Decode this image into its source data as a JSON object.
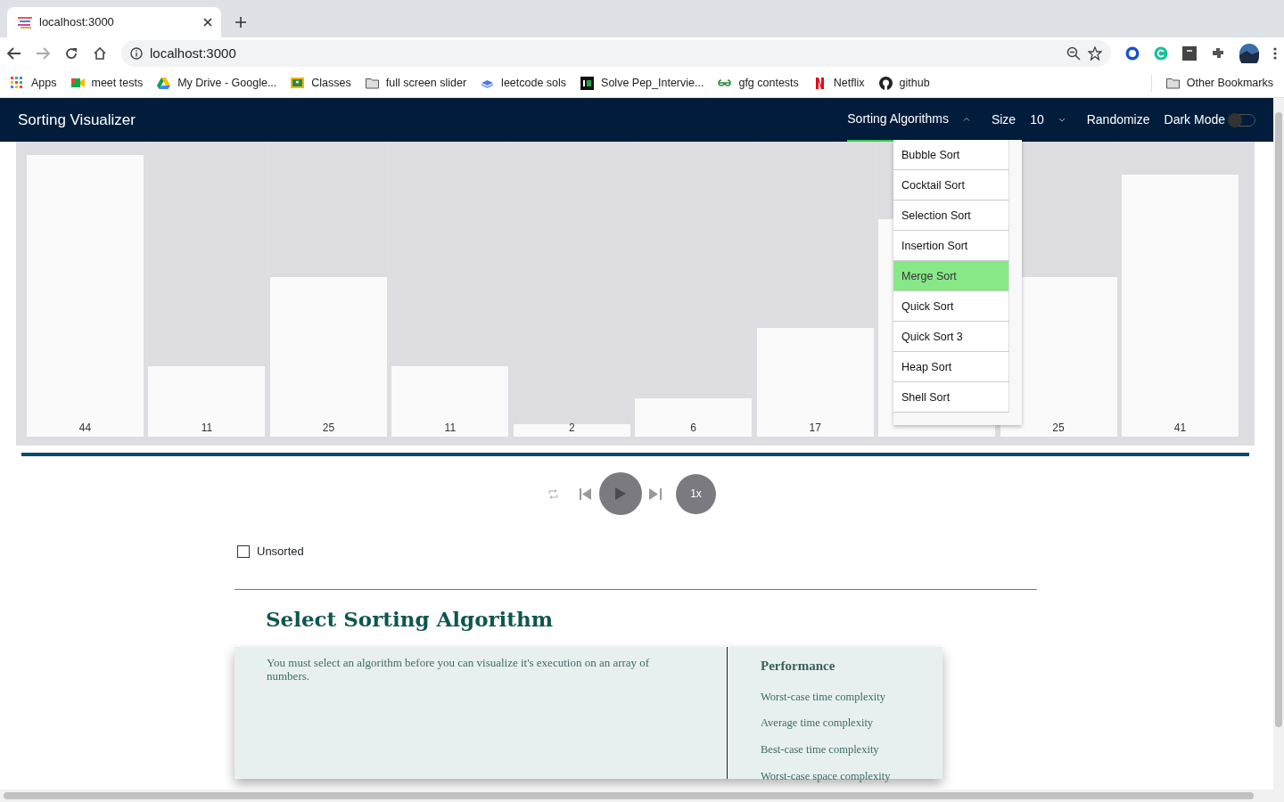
{
  "browser": {
    "tab": {
      "title": "localhost:3000"
    },
    "address": "localhost:3000",
    "bookmarks": [
      {
        "label": "Apps",
        "kind": "apps"
      },
      {
        "label": "meet tests",
        "kind": "meet"
      },
      {
        "label": "My Drive - Google...",
        "kind": "drive"
      },
      {
        "label": "Classes",
        "kind": "classroom"
      },
      {
        "label": "full screen slider",
        "kind": "folder"
      },
      {
        "label": "leetcode sols",
        "kind": "stack"
      },
      {
        "label": "Solve Pep_Intervie...",
        "kind": "hr"
      },
      {
        "label": "gfg contests",
        "kind": "gfg"
      },
      {
        "label": "Netflix",
        "kind": "netflix"
      },
      {
        "label": "github",
        "kind": "github"
      }
    ],
    "other_bookmarks": "Other Bookmarks"
  },
  "app": {
    "title": "Sorting Visualizer",
    "algorithms_menu": {
      "label": "Sorting Algorithms",
      "expanded": true,
      "items": [
        {
          "label": "Bubble Sort",
          "selected": false
        },
        {
          "label": "Cocktail Sort",
          "selected": false
        },
        {
          "label": "Selection Sort",
          "selected": false
        },
        {
          "label": "Insertion Sort",
          "selected": false
        },
        {
          "label": "Merge Sort",
          "selected": true
        },
        {
          "label": "Quick Sort",
          "selected": false
        },
        {
          "label": "Quick Sort 3",
          "selected": false
        },
        {
          "label": "Heap Sort",
          "selected": false
        },
        {
          "label": "Shell Sort",
          "selected": false
        }
      ]
    },
    "size": {
      "label": "Size",
      "value": "10"
    },
    "randomize": "Randomize",
    "dark_mode": {
      "label": "Dark Mode",
      "on": false
    }
  },
  "array_bars": [
    {
      "label": "44",
      "level": 0.957
    },
    {
      "label": "11",
      "level": 0.239
    },
    {
      "label": "25",
      "level": 0.543
    },
    {
      "label": "11",
      "level": 0.239
    },
    {
      "label": "2",
      "level": 0.043
    },
    {
      "label": "6",
      "level": 0.13
    },
    {
      "label": "17",
      "level": 0.37
    },
    {
      "level": 0.739
    },
    {
      "label": "25",
      "level": 0.543
    },
    {
      "label": "41",
      "level": 0.891
    }
  ],
  "progress": {
    "level": 1
  },
  "player": {
    "speed": "1x"
  },
  "unsorted": {
    "label": "Unsorted",
    "checked": false
  },
  "info": {
    "heading": "Select Sorting Algorithm",
    "description": "You must select an algorithm before you can visualize it's execution on an array of numbers.",
    "performance": {
      "title": "Performance",
      "items": [
        "Worst-case time complexity",
        "Average time complexity",
        "Best-case time complexity",
        "Worst-case space complexity"
      ]
    }
  }
}
